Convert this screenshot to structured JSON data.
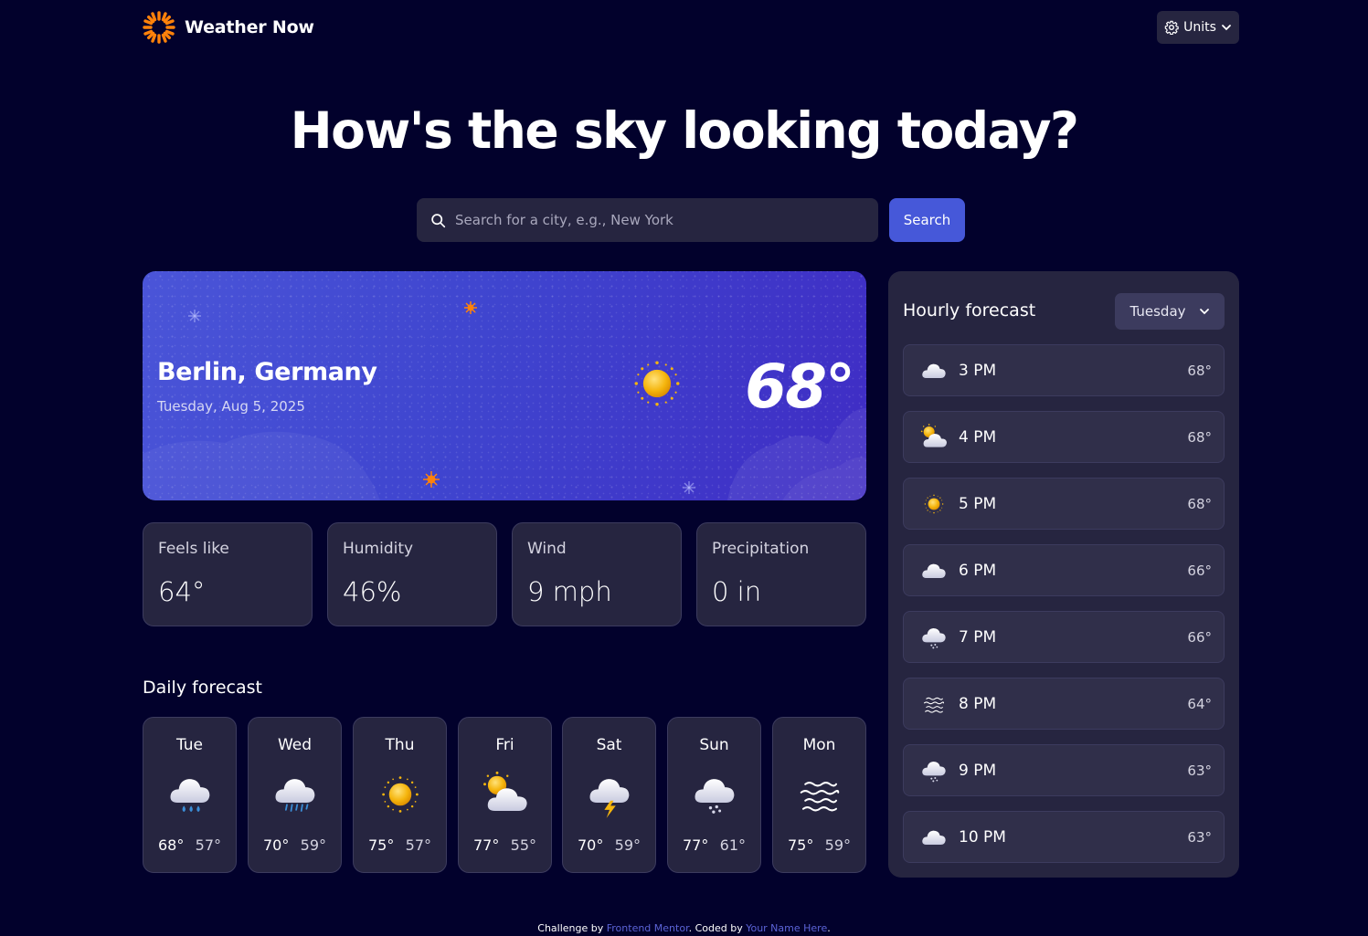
{
  "header": {
    "app_name": "Weather Now",
    "units_label": "Units"
  },
  "hero": {
    "title": "How's the sky looking today?"
  },
  "search": {
    "placeholder": "Search for a city, e.g., New York",
    "button_label": "Search"
  },
  "current": {
    "city": "Berlin, Germany",
    "date": "Tuesday, Aug 5, 2025",
    "temperature": "68°",
    "icon": "sunny-icon"
  },
  "stats": [
    {
      "label": "Feels like",
      "value": "64°"
    },
    {
      "label": "Humidity",
      "value": "46%"
    },
    {
      "label": "Wind",
      "value": "9 mph"
    },
    {
      "label": "Precipitation",
      "value": "0 in"
    }
  ],
  "daily": {
    "title": "Daily forecast",
    "days": [
      {
        "day": "Tue",
        "icon": "rain-icon",
        "high": "68°",
        "low": "57°"
      },
      {
        "day": "Wed",
        "icon": "drizzle-icon",
        "high": "70°",
        "low": "59°"
      },
      {
        "day": "Thu",
        "icon": "sunny-icon",
        "high": "75°",
        "low": "57°"
      },
      {
        "day": "Fri",
        "icon": "partly-cloudy-icon",
        "high": "77°",
        "low": "55°"
      },
      {
        "day": "Sat",
        "icon": "storm-icon",
        "high": "70°",
        "low": "59°"
      },
      {
        "day": "Sun",
        "icon": "snow-icon",
        "high": "77°",
        "low": "61°"
      },
      {
        "day": "Mon",
        "icon": "fog-icon",
        "high": "75°",
        "low": "59°"
      }
    ]
  },
  "hourly": {
    "title": "Hourly forecast",
    "selected_day": "Tuesday",
    "hours": [
      {
        "time": "3 PM",
        "icon": "cloud-icon",
        "temp": "68°"
      },
      {
        "time": "4 PM",
        "icon": "partly-cloudy-icon",
        "temp": "68°"
      },
      {
        "time": "5 PM",
        "icon": "sunny-icon",
        "temp": "68°"
      },
      {
        "time": "6 PM",
        "icon": "cloud-icon",
        "temp": "66°"
      },
      {
        "time": "7 PM",
        "icon": "snow-icon",
        "temp": "66°"
      },
      {
        "time": "8 PM",
        "icon": "fog-icon",
        "temp": "64°"
      },
      {
        "time": "9 PM",
        "icon": "snow-icon",
        "temp": "63°"
      },
      {
        "time": "10 PM",
        "icon": "cloud-icon",
        "temp": "63°"
      }
    ]
  },
  "footer": {
    "prefix": "Challenge by",
    "link1": "Frontend Mentor",
    "middle": ". Coded by",
    "link2": "Your Name Here",
    "suffix": "."
  },
  "colors": {
    "background": "#02012c",
    "card": "#262540",
    "accent": "#4658d9",
    "sun": "#f5b50d",
    "logo": "#ff820a"
  }
}
